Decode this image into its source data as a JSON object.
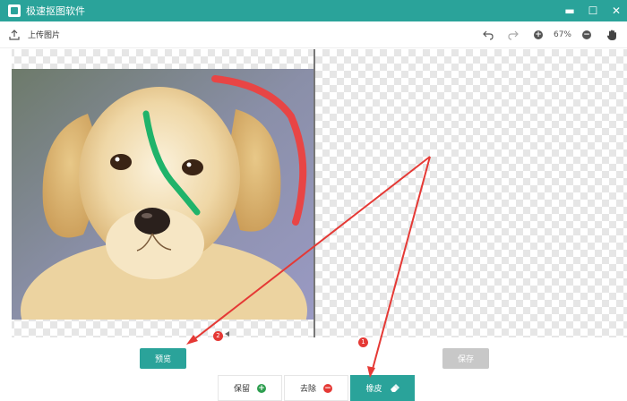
{
  "window": {
    "title": "极速抠图软件"
  },
  "toolbar": {
    "upload_label": "上传图片",
    "zoom": "67%"
  },
  "actions": {
    "preview_label": "预览",
    "save_label": "保存"
  },
  "tools": [
    {
      "label": "保留",
      "icon": "plus-circle-icon",
      "color": "#2e9e4f"
    },
    {
      "label": "去除",
      "icon": "minus-circle-icon",
      "color": "#e53935"
    },
    {
      "label": "橡皮",
      "icon": "eraser-icon"
    }
  ],
  "annotations": {
    "badge1": "1",
    "badge2": "2"
  },
  "colors": {
    "accent": "#2aa39a",
    "keep_stroke": "#1fb36a",
    "remove_stroke": "#e84545",
    "arrow": "#e53935"
  }
}
